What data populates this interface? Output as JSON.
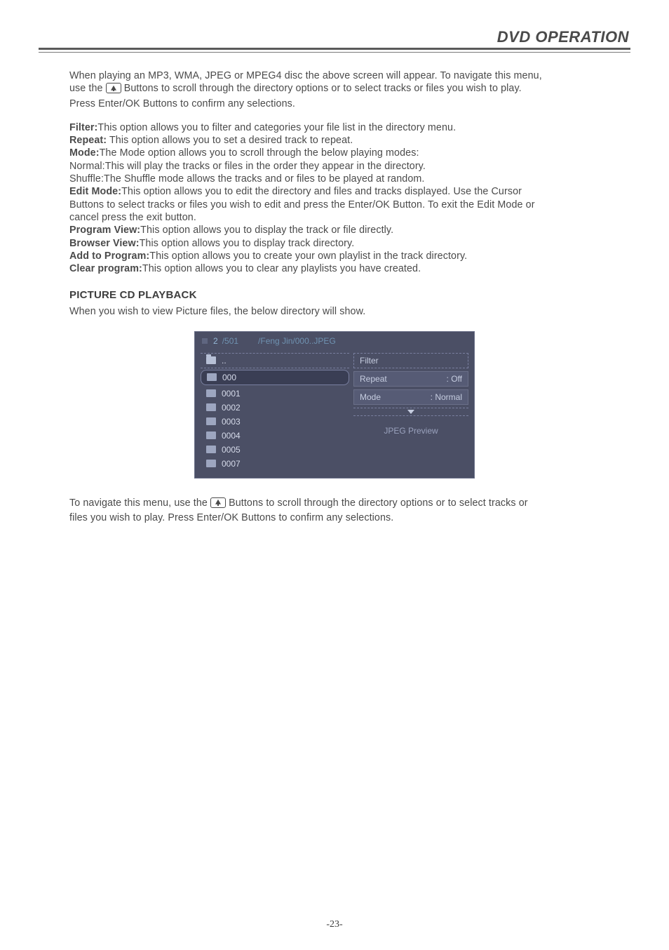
{
  "header": {
    "title": "DVD OPERATION"
  },
  "intro": {
    "line1a": "When playing an MP3, WMA, JPEG or MPEG4 disc the above screen will appear. To navigate this menu,",
    "line2a": "use the ",
    "line2b": " Buttons to scroll through the directory options or to select tracks or files you wish to play.",
    "line3": "Press Enter/OK Buttons to confirm any selections."
  },
  "defs": {
    "filter_label": "Filter:",
    "filter_text": "This option allows you to filter and categories your file list in the directory menu.",
    "repeat_label": "Repeat:",
    "repeat_text": " This option allows you to set a desired track to repeat.",
    "mode_label": "Mode:",
    "mode_text": "The Mode option allows you to scroll through the below playing modes:",
    "normal_text": "Normal:This will play the tracks or files in the order they appear in the directory.",
    "shuffle_text": "Shuffle:The Shuffle mode allows the tracks and or files to be played at random.",
    "edit_label": "Edit Mode:",
    "edit_text1": "This option allows you to edit the directory and files and tracks displayed. Use the Cursor",
    "edit_text2": "Buttons to select tracks or files you wish to edit and press the Enter/OK Button. To exit the Edit Mode or",
    "edit_text3": "cancel press the exit button.",
    "progview_label": "Program View:",
    "progview_text": "This option allows you to display the track or file directly.",
    "browser_label": "Browser View:",
    "browser_text": "This option allows you to display track directory.",
    "add_label": "Add to Program:",
    "add_text": "This option allows you to create your own playlist in the track directory.",
    "clear_label": "Clear program:",
    "clear_text": "This option allows you to clear any playlists you have created."
  },
  "section": {
    "title": "PICTURE CD PLAYBACK",
    "subtitle": "When you wish to view Picture files, the below directory will show."
  },
  "ui": {
    "top": {
      "current": "2",
      "total": "/501",
      "path": "/Feng Jin/000..JPEG"
    },
    "left": {
      "up": "..",
      "sel": "000",
      "items": [
        "0001",
        "0002",
        "0003",
        "0004",
        "0005",
        "0007"
      ]
    },
    "right": {
      "filter": "Filter",
      "repeat_l": "Repeat",
      "repeat_v": ":  Off",
      "mode_l": "Mode",
      "mode_v": ":  Normal",
      "preview": "JPEG Preview"
    }
  },
  "outro": {
    "a": "To navigate this menu, use the ",
    "b": " Buttons to scroll through the directory options or to select tracks or",
    "c": "files you wish to play. Press Enter/OK Buttons to confirm any selections."
  },
  "footer": {
    "page": "-23-"
  }
}
